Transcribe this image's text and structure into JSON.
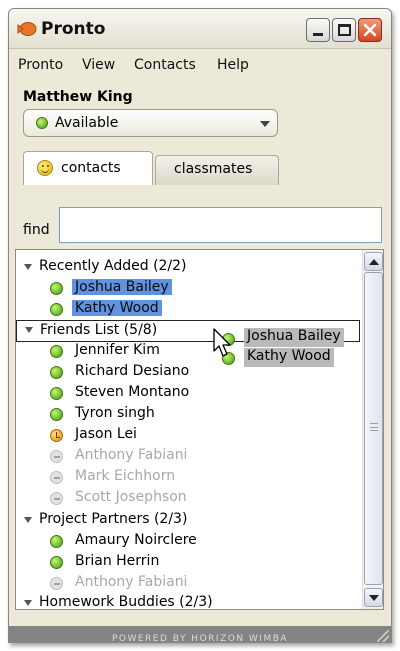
{
  "window": {
    "title": "Pronto",
    "controls": {
      "minimize": "minimize-button",
      "maximize": "maximize-button",
      "close": "close-button"
    }
  },
  "menu": [
    "Pronto",
    "View",
    "Contacts",
    "Help"
  ],
  "user": {
    "name": "Matthew King"
  },
  "status": {
    "value": "Available",
    "color": "#4caf1a"
  },
  "tabs": [
    {
      "label": "contacts",
      "active": true,
      "icon": "smiley-icon"
    },
    {
      "label": "classmates",
      "active": false
    }
  ],
  "find": {
    "label": "find",
    "value": ""
  },
  "groups": [
    {
      "label": "Recently Added  (2/2)",
      "contacts": [
        {
          "name": "Joshua Bailey",
          "status": "online",
          "selected": true
        },
        {
          "name": "Kathy Wood",
          "status": "online",
          "selected": true
        }
      ]
    },
    {
      "label": "Friends List  (5/8)",
      "drop_target": true,
      "contacts": [
        {
          "name": "Jennifer Kim",
          "status": "online"
        },
        {
          "name": "Richard Desiano",
          "status": "online"
        },
        {
          "name": "Steven Montano",
          "status": "online"
        },
        {
          "name": "Tyron singh",
          "status": "online"
        },
        {
          "name": "Jason Lei",
          "status": "away"
        },
        {
          "name": "Anthony Fabiani",
          "status": "offline"
        },
        {
          "name": "Mark Eichhorn",
          "status": "offline"
        },
        {
          "name": "Scott Josephson",
          "status": "offline"
        }
      ]
    },
    {
      "label": "Project Partners  (2/3)",
      "contacts": [
        {
          "name": "Amaury Noirclere",
          "status": "online"
        },
        {
          "name": "Brian Herrin",
          "status": "online"
        },
        {
          "name": "Anthony Fabiani",
          "status": "offline"
        }
      ]
    },
    {
      "label": "Homework Buddies  (2/3)",
      "contacts": []
    }
  ],
  "drag": {
    "items": [
      "Joshua Bailey",
      "Kathy Wood"
    ]
  },
  "footer": "POWERED BY HORIZON WIMBA",
  "colors": {
    "online": "#3f9a0c",
    "away": "#e08a0b",
    "offline": "#bdbdbd",
    "selection": "#5f93df"
  }
}
